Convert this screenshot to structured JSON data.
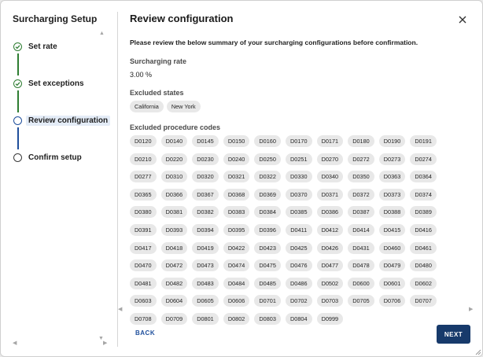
{
  "sidebar": {
    "title": "Surcharging Setup",
    "steps": [
      {
        "label": "Set rate",
        "state": "done"
      },
      {
        "label": "Set exceptions",
        "state": "done"
      },
      {
        "label": "Review configuration",
        "state": "active"
      },
      {
        "label": "Confirm setup",
        "state": "todo"
      }
    ]
  },
  "main": {
    "title": "Review configuration",
    "intro": "Please review the below summary of your surcharging configurations before confirmation.",
    "rate": {
      "label": "Surcharging rate",
      "value": "3.00 %"
    },
    "states": {
      "label": "Excluded states",
      "items": [
        "California",
        "New York"
      ]
    },
    "codes": {
      "label": "Excluded procedure codes",
      "items": [
        "D0120",
        "D0140",
        "D0145",
        "D0150",
        "D0160",
        "D0170",
        "D0171",
        "D0180",
        "D0190",
        "D0191",
        "D0210",
        "D0220",
        "D0230",
        "D0240",
        "D0250",
        "D0251",
        "D0270",
        "D0272",
        "D0273",
        "D0274",
        "D0277",
        "D0310",
        "D0320",
        "D0321",
        "D0322",
        "D0330",
        "D0340",
        "D0350",
        "D0363",
        "D0364",
        "D0365",
        "D0366",
        "D0367",
        "D0368",
        "D0369",
        "D0370",
        "D0371",
        "D0372",
        "D0373",
        "D0374",
        "D0380",
        "D0381",
        "D0382",
        "D0383",
        "D0384",
        "D0385",
        "D0386",
        "D0387",
        "D0388",
        "D0389",
        "D0391",
        "D0393",
        "D0394",
        "D0395",
        "D0396",
        "D0411",
        "D0412",
        "D0414",
        "D0415",
        "D0416",
        "D0417",
        "D0418",
        "D0419",
        "D0422",
        "D0423",
        "D0425",
        "D0426",
        "D0431",
        "D0460",
        "D0461",
        "D0470",
        "D0472",
        "D0473",
        "D0474",
        "D0475",
        "D0476",
        "D0477",
        "D0478",
        "D0479",
        "D0480",
        "D0481",
        "D0482",
        "D0483",
        "D0484",
        "D0485",
        "D0486",
        "D0502",
        "D0600",
        "D0601",
        "D0602",
        "D0603",
        "D0604",
        "D0605",
        "D0606",
        "D0701",
        "D0702",
        "D0703",
        "D0705",
        "D0706",
        "D0707",
        "D0708",
        "D0709",
        "D0801",
        "D0802",
        "D0803",
        "D0804",
        "D0999"
      ]
    },
    "actions": {
      "back_label": "BACK",
      "next_label": "NEXT"
    }
  },
  "colors": {
    "primary": "#173a6b",
    "done": "#2e7d32",
    "active": "#1f4f9c",
    "chip": "#e8e8e8"
  }
}
